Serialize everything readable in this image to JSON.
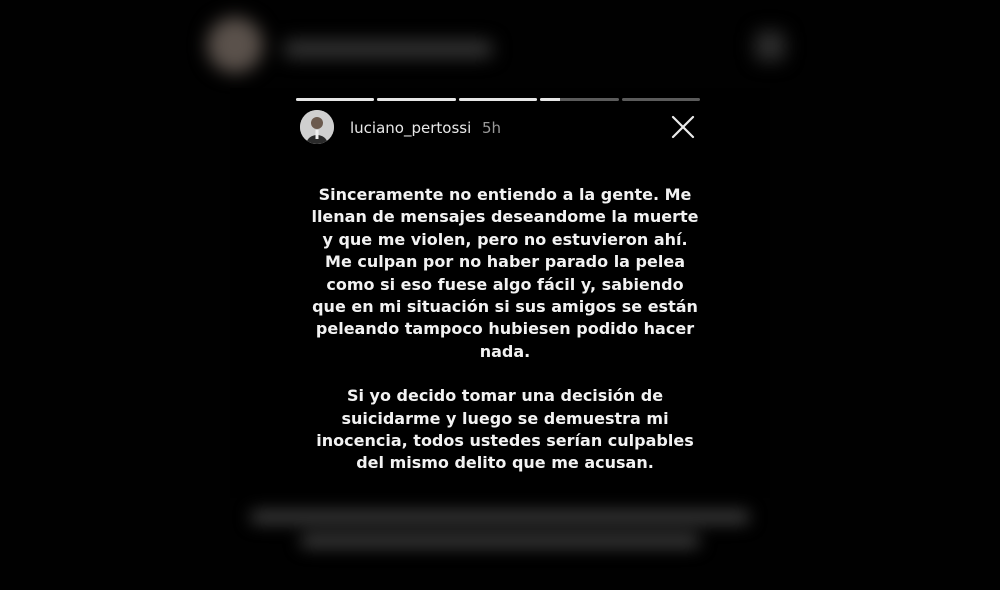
{
  "story": {
    "username": "luciano_pertossi",
    "time_ago": "5h",
    "progress_segments": [
      1,
      1,
      1,
      0.25,
      0
    ],
    "paragraphs": [
      "Sinceramente no entiendo a la gente. Me llenan de mensajes deseandome la muerte y que me violen, pero no estuvieron ahí. Me culpan por no haber parado la pelea como si eso fuese algo fácil y, sabiendo que en mi situación si sus amigos se están peleando tampoco hubiesen podido hacer nada.",
      "Si yo decido tomar una decisión de suicidarme y luego se demuestra mi inocencia, todos ustedes serían culpables del mismo delito que me acusan."
    ],
    "close_icon": "close-icon",
    "avatar_icon": "profile-avatar"
  },
  "colors": {
    "background": "#000000",
    "text": "#f2f2f2",
    "progress_active": "#e6e6e6",
    "progress_inactive": "#5b5b5b",
    "time": "#9a9a9a"
  }
}
